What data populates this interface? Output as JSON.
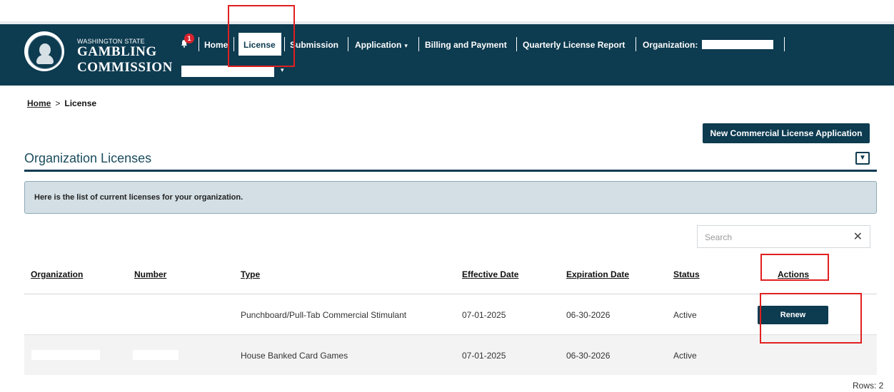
{
  "brand": {
    "line_small": "WASHINGTON STATE",
    "line1": "GAMBLING",
    "line2": "COMMISSION",
    "seal_icon": "state-seal-logo"
  },
  "nav": {
    "notification_count": "1",
    "items": {
      "home": "Home",
      "license": "License",
      "submission": "Submission",
      "application": "Application",
      "billing": "Billing and Payment",
      "quarterly": "Quarterly License Report",
      "organization": "Organization:"
    },
    "dropdown_caret": "▾"
  },
  "breadcrumb": {
    "home": "Home",
    "separator": ">",
    "current": "License"
  },
  "actions": {
    "new_application": "New Commercial License Application"
  },
  "section": {
    "title": "Organization Licenses",
    "collapse_glyph": "▼",
    "info": "Here is the list of current licenses for your organization."
  },
  "search": {
    "placeholder": "Search",
    "clear_glyph": "✕"
  },
  "table": {
    "columns": {
      "organization": "Organization",
      "number": "Number",
      "type": "Type",
      "effective": "Effective Date",
      "expiration": "Expiration Date",
      "status": "Status",
      "actions": "Actions"
    },
    "rows": [
      {
        "organization": "",
        "number": "",
        "type": "Punchboard/Pull-Tab Commercial Stimulant",
        "effective": "07-01-2025",
        "expiration": "06-30-2026",
        "status": "Active",
        "action": "Renew"
      },
      {
        "organization": "",
        "number": "",
        "type": "House Banked Card Games",
        "effective": "07-01-2025",
        "expiration": "06-30-2026",
        "status": "Active",
        "action": ""
      }
    ],
    "row_count": "Rows: 2"
  },
  "colors": {
    "brand_dark": "#0d3b50",
    "annotation_red": "#e02020",
    "badge_red": "#d9232e"
  }
}
